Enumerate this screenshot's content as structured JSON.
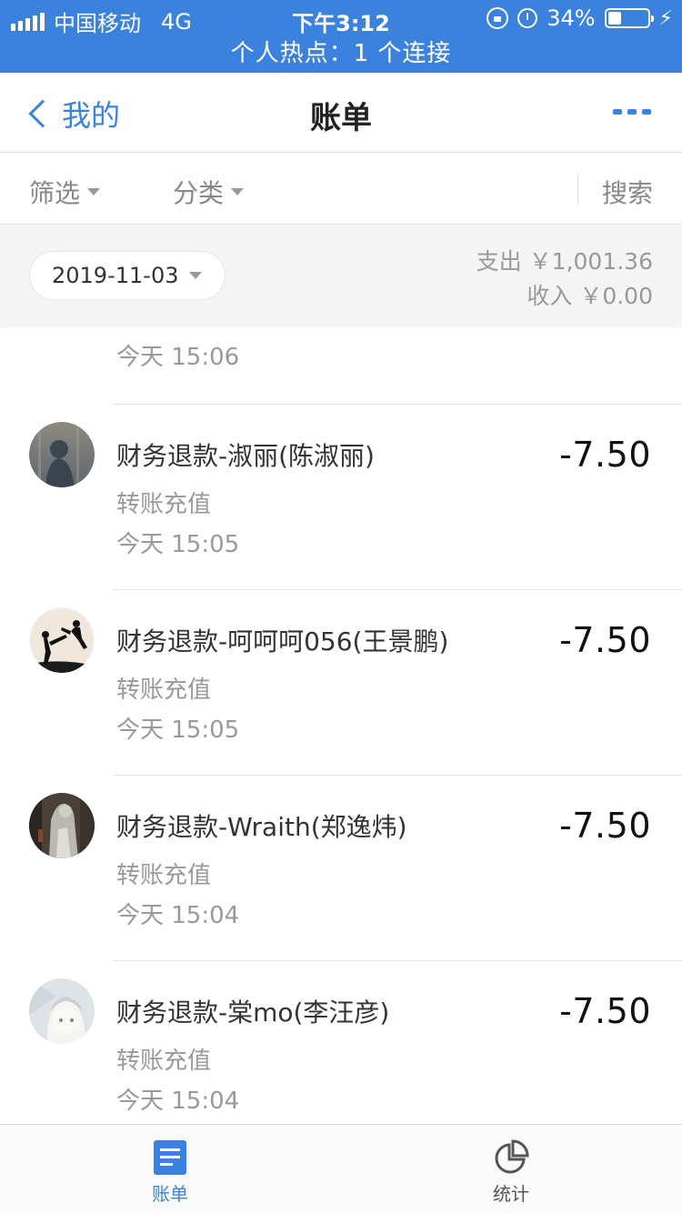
{
  "status_bar": {
    "carrier": "中国移动",
    "network": "4G",
    "time": "下午3:12",
    "battery": "34%",
    "battery_level": 0.34,
    "hotspot": "个人热点：1 个连接"
  },
  "nav": {
    "back_label": "我的",
    "title": "账单"
  },
  "filters": {
    "filter_label": "筛选",
    "category_label": "分类",
    "search_label": "搜索"
  },
  "summary": {
    "date": "2019-11-03",
    "expense": "支出 ￥1,001.36",
    "income": "收入 ￥0.00"
  },
  "partial_item": {
    "time": "今天  15:06"
  },
  "transactions": [
    {
      "title": "财务退款-淑丽(陈淑丽)",
      "category": "转账充值",
      "time": "今天  15:05",
      "amount": "-7.50",
      "avatar": "person-in-fog-avatar"
    },
    {
      "title": "财务退款-呵呵呵056(王景鹏)",
      "category": "转账充值",
      "time": "今天  15:05",
      "amount": "-7.50",
      "avatar": "martial-arts-silhouette-avatar"
    },
    {
      "title": "财务退款-Wraith(郑逸炜)",
      "category": "转账充值",
      "time": "今天  15:04",
      "amount": "-7.50",
      "avatar": "statue-avatar"
    },
    {
      "title": "财务退款-棠mo(李汪彦)",
      "category": "转账充值",
      "time": "今天  15:04",
      "amount": "-7.50",
      "avatar": "anime-girl-avatar"
    }
  ],
  "tabbar": {
    "bill_label": "账单",
    "stats_label": "统计"
  },
  "colors": {
    "accent": "#3a82de",
    "status_bar_bg": "#3a82de",
    "summary_bg": "#f4f4f4"
  }
}
